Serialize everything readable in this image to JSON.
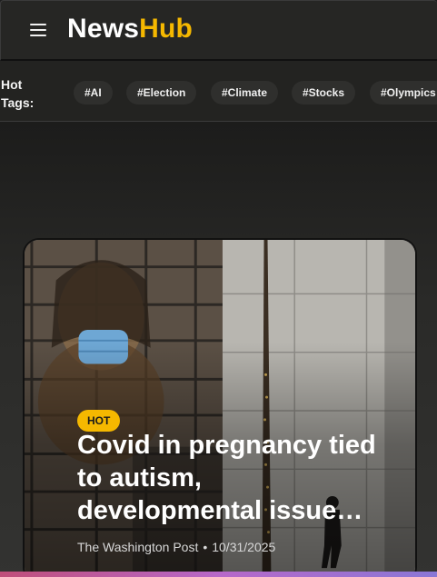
{
  "header": {
    "logo_part1": "News",
    "logo_part2": "Hub",
    "brand_color": "#f5b800",
    "menu_icon": "hamburger-menu-icon"
  },
  "tags": {
    "label": "Hot Tags:",
    "items": [
      "#AI",
      "#Election",
      "#Climate",
      "#Stocks",
      "#Olympics"
    ]
  },
  "featured": {
    "badge": "HOT",
    "title": "Covid in pregnancy tied to autism, developmental issue…",
    "source": "The Washington Post",
    "separator": "•",
    "date": "10/31/2025"
  }
}
